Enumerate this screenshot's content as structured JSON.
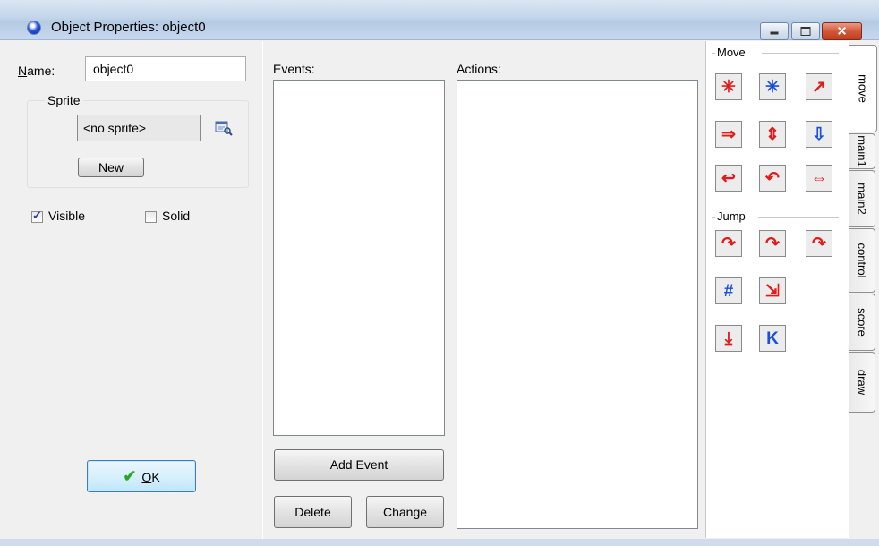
{
  "window": {
    "title": "Object Properties: object0",
    "controls": {
      "minimize": "",
      "maximize": "",
      "close": "✕"
    }
  },
  "properties": {
    "name_label_accel": "N",
    "name_label_rest": "ame:",
    "name_value": "object0",
    "sprite_group": "Sprite",
    "sprite_value": "<no sprite>",
    "new_button": "New",
    "visible_label": "Visible",
    "visible_checked": true,
    "solid_label": "Solid",
    "solid_checked": false,
    "ok_button_accel": "O",
    "ok_button_rest": "K"
  },
  "events": {
    "label": "Events:",
    "items": [],
    "add_event_button": "Add Event",
    "delete_button": "Delete",
    "change_button": "Change"
  },
  "actions": {
    "label": "Actions:",
    "items": []
  },
  "library": {
    "groups": [
      {
        "name": "Move",
        "actions": [
          {
            "icon": "move-fixed-icon",
            "glyph": "✳",
            "color": "red"
          },
          {
            "icon": "move-free-icon",
            "glyph": "✳",
            "color": "blue"
          },
          {
            "icon": "move-towards-icon",
            "glyph": "↗",
            "color": "red"
          },
          {
            "icon": "speed-horizontal-icon",
            "glyph": "⇒",
            "color": "red"
          },
          {
            "icon": "speed-vertical-icon",
            "glyph": "⇕",
            "color": "red"
          },
          {
            "icon": "set-gravity-icon",
            "glyph": "⇩",
            "color": "blue"
          },
          {
            "icon": "reverse-horizontal-icon",
            "glyph": "↩",
            "color": "red"
          },
          {
            "icon": "reverse-vertical-icon",
            "glyph": "↶",
            "color": "red"
          },
          {
            "icon": "set-friction-icon",
            "glyph": "⇔",
            "color": "red"
          }
        ]
      },
      {
        "name": "Jump",
        "actions": [
          {
            "icon": "jump-to-position-icon",
            "glyph": "↷",
            "color": "red"
          },
          {
            "icon": "jump-to-start-icon",
            "glyph": "↷",
            "color": "red"
          },
          {
            "icon": "jump-to-random-icon",
            "glyph": "↷",
            "color": "red"
          },
          {
            "icon": "align-to-grid-icon",
            "glyph": "#",
            "color": "blue"
          },
          {
            "icon": "wrap-screen-icon",
            "glyph": "⇲",
            "color": "red"
          },
          {
            "icon": "move-to-contact-icon",
            "glyph": "⤓",
            "color": "red"
          },
          {
            "icon": "bounce-icon",
            "glyph": "K",
            "color": "blue"
          }
        ]
      }
    ],
    "tabs": [
      "move",
      "main1",
      "main2",
      "control",
      "score",
      "draw"
    ],
    "active_tab": "move"
  }
}
